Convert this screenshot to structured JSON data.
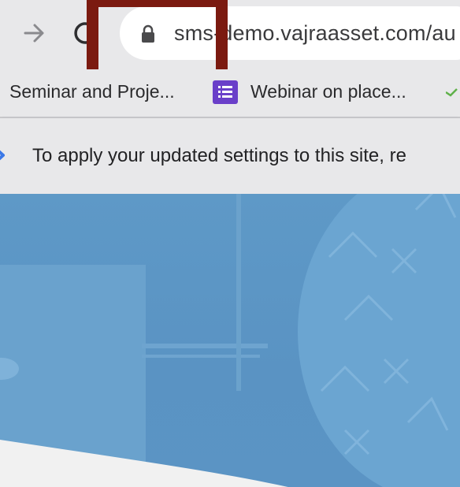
{
  "browser": {
    "url": "sms-demo.vajraasset.com/au",
    "bookmarks": [
      {
        "label": "Seminar and Proje..."
      },
      {
        "label": "Webinar on place..."
      }
    ],
    "infobar_text": "To apply your updated settings to this site, re"
  },
  "colors": {
    "highlight": "#7b1a10",
    "hero": "#5e99c7",
    "bookmark_form_icon": "#6a3fc9"
  },
  "icons": {
    "forward": "forward-arrow-icon",
    "reload": "reload-icon",
    "lock": "lock-icon",
    "forms": "google-forms-icon",
    "extension": "extension-icon",
    "info": "info-icon"
  }
}
